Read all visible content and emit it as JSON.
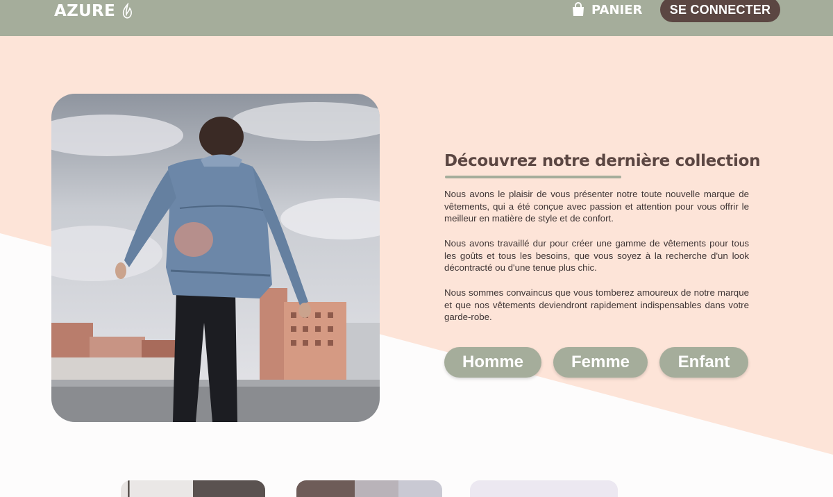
{
  "header": {
    "logo_text": "AZURE",
    "logo_icon": "leaf-drop-icon",
    "cart_label": "PANIER",
    "cart_icon": "shopping-bag-icon",
    "login_label": "SE CONNECTER"
  },
  "hero": {
    "image": "man-denim-jacket-rooftop-photo",
    "title": "Découvrez notre dernière collection",
    "paragraphs": [
      "Nous avons le plaisir de vous présenter notre toute nouvelle marque de vêtements, qui a été conçue avec passion et attention pour vous offrir le meilleur en matière de style et de confort.",
      "Nous avons travaillé dur pour créer une gamme de vêtements pour tous les goûts et tous les besoins, que vous soyez à la recherche d'un look décontracté ou d'une tenue plus chic.",
      "Nous sommes convaincus que vous tomberez amoureux de notre marque et que nos vêtements deviendront rapidement indispensables dans votre garde-robe."
    ],
    "categories": [
      "Homme",
      "Femme",
      "Enfant"
    ]
  },
  "colors": {
    "header_bg": "#a5ad9b",
    "accent_brown": "#5b4642",
    "peach_bg": "#fde4d8",
    "button_bg": "#a5ad9b"
  }
}
